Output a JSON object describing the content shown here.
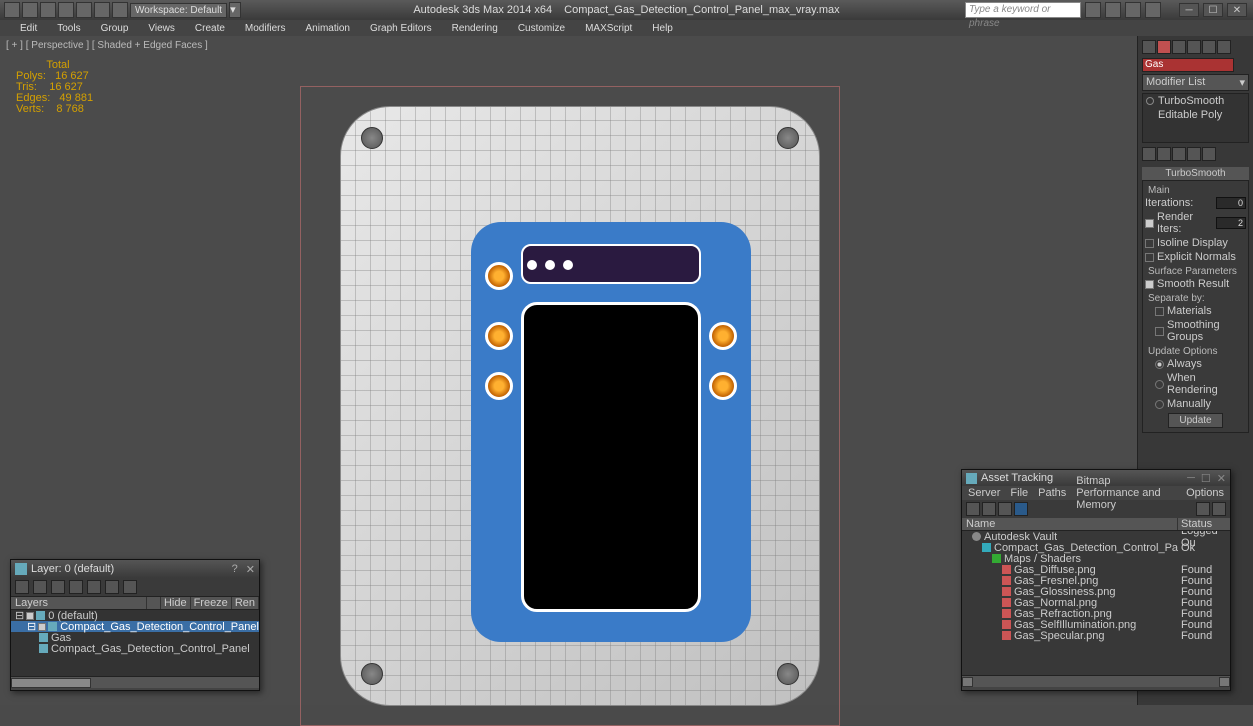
{
  "title": {
    "app": "Autodesk 3ds Max 2014 x64",
    "file": "Compact_Gas_Detection_Control_Panel_max_vray.max",
    "workspace_label": "Workspace: Default",
    "search_placeholder": "Type a keyword or phrase"
  },
  "menus": [
    "Edit",
    "Tools",
    "Group",
    "Views",
    "Create",
    "Modifiers",
    "Animation",
    "Graph Editors",
    "Rendering",
    "Customize",
    "MAXScript",
    "Help"
  ],
  "viewport": {
    "label": "[ + ] [ Perspective ] [ Shaded + Edged Faces ]",
    "stats": {
      "header": "          Total",
      "polys": "Polys:   16 627",
      "tris": "Tris:    16 627",
      "edges": "Edges:   49 881",
      "verts": "Verts:    8 768"
    }
  },
  "command_panel": {
    "object_name": "Gas",
    "modifier_list_label": "Modifier List",
    "stack": [
      "TurboSmooth",
      "Editable Poly"
    ],
    "turbosmooth": {
      "title": "TurboSmooth",
      "main_label": "Main",
      "iterations_label": "Iterations:",
      "iterations_value": "0",
      "render_iters_label": "Render Iters:",
      "render_iters_value": "2",
      "isoline_label": "Isoline Display",
      "explicit_normals_label": "Explicit Normals",
      "surface_params_label": "Surface Parameters",
      "smooth_result_label": "Smooth Result",
      "separate_label": "Separate by:",
      "materials_label": "Materials",
      "smoothing_groups_label": "Smoothing Groups",
      "update_options_label": "Update Options",
      "always_label": "Always",
      "when_rendering_label": "When Rendering",
      "manually_label": "Manually",
      "update_btn": "Update"
    }
  },
  "layer_panel": {
    "title": "Layer: 0 (default)",
    "columns": [
      "Layers",
      "",
      "Hide",
      "Freeze",
      "Ren"
    ],
    "tree": [
      {
        "indent": 0,
        "label": "0 (default)",
        "sel": false,
        "checked": true
      },
      {
        "indent": 1,
        "label": "Compact_Gas_Detection_Control_Panel",
        "sel": true,
        "checked": true
      },
      {
        "indent": 2,
        "label": "Gas",
        "sel": false,
        "checked": false
      },
      {
        "indent": 2,
        "label": "Compact_Gas_Detection_Control_Panel",
        "sel": false,
        "checked": false
      }
    ]
  },
  "asset_panel": {
    "title": "Asset Tracking",
    "menus": [
      "Server",
      "File",
      "Paths",
      "Bitmap Performance and Memory",
      "Options"
    ],
    "columns": [
      "Name",
      "Status"
    ],
    "rows": [
      {
        "indent": 10,
        "icon": "vault",
        "name": "Autodesk Vault",
        "status": "Logged Ou"
      },
      {
        "indent": 20,
        "icon": "max",
        "name": "Compact_Gas_Detection_Control_Panel_max_vray.max",
        "status": "Ok"
      },
      {
        "indent": 30,
        "icon": "grp",
        "name": "Maps / Shaders",
        "status": ""
      },
      {
        "indent": 40,
        "icon": "map",
        "name": "Gas_Diffuse.png",
        "status": "Found"
      },
      {
        "indent": 40,
        "icon": "map",
        "name": "Gas_Fresnel.png",
        "status": "Found"
      },
      {
        "indent": 40,
        "icon": "map",
        "name": "Gas_Glossiness.png",
        "status": "Found"
      },
      {
        "indent": 40,
        "icon": "map",
        "name": "Gas_Normal.png",
        "status": "Found"
      },
      {
        "indent": 40,
        "icon": "map",
        "name": "Gas_Refraction.png",
        "status": "Found"
      },
      {
        "indent": 40,
        "icon": "map",
        "name": "Gas_SelfIllumination.png",
        "status": "Found"
      },
      {
        "indent": 40,
        "icon": "map",
        "name": "Gas_Specular.png",
        "status": "Found"
      }
    ]
  }
}
